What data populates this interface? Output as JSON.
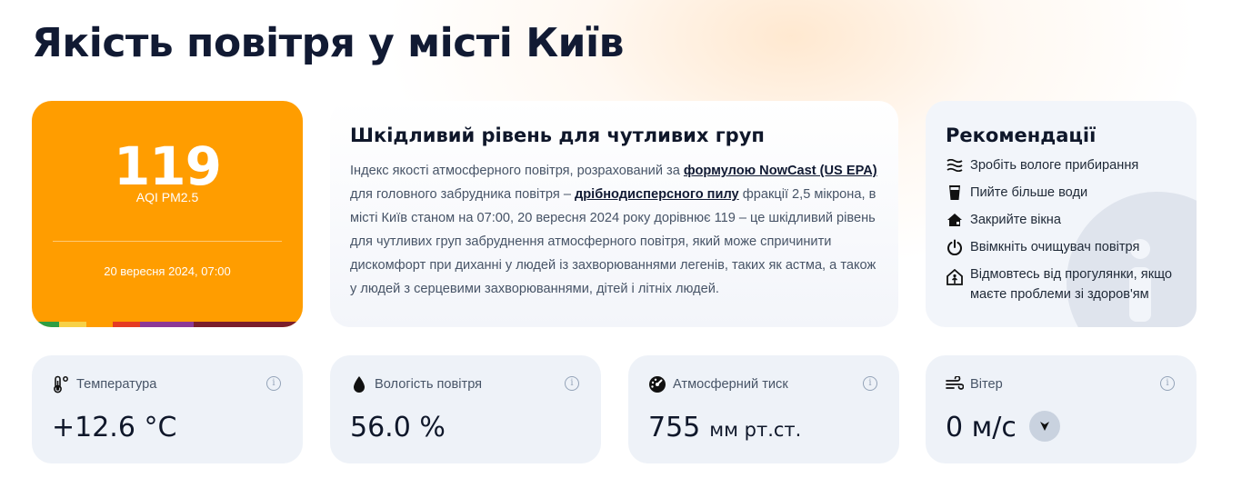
{
  "page": {
    "title": "Якість повітря у місті Київ"
  },
  "aqi": {
    "value": "119",
    "label": "AQI PM2.5",
    "date": "20 вересня 2024, 07:00",
    "color": "#ff9d00",
    "scale_colors": [
      "#2e9e44",
      "#f7d147",
      "#ff9d00",
      "#e53b23",
      "#8b3a96",
      "#7a1f2b"
    ]
  },
  "description": {
    "heading": "Шкідливий рівень для чутливих груп",
    "text_1": "Індекс якості атмосферного повітря, розрахований за ",
    "link_1": "формулою NowCast (US EPA)",
    "text_2": " для головного забрудника повітря – ",
    "link_2": "дрібнодисперсного пилу",
    "text_3": " фракції 2,5 мікрона, в місті Київ станом на 07:00, 20 вересня 2024 року дорівнює 119 – це шкідливий рівень для чутливих груп забруднення атмосферного повітря, який може спричинити дискомфорт при диханні у людей із захворюваннями легенів, таких як астма, а також у людей з серцевими захворюваннями, дітей і літніх людей."
  },
  "recommendations": {
    "heading": "Рекомендації",
    "items": [
      {
        "icon": "wet-cleaning-icon",
        "label": "Зробіть вологе прибирання"
      },
      {
        "icon": "water-glass-icon",
        "label": "Пийте більше води"
      },
      {
        "icon": "house-icon",
        "label": "Закрийте вікна"
      },
      {
        "icon": "power-icon",
        "label": "Ввімкніть очищувач повітря"
      },
      {
        "icon": "stay-home-icon",
        "label": "Відмовтесь від прогулянки, якщо маєте проблеми зі здоров'ям"
      }
    ]
  },
  "weather": {
    "temperature": {
      "label": "Температура",
      "value": "+12.6 °C"
    },
    "humidity": {
      "label": "Вологість повітря",
      "value": "56.0 %"
    },
    "pressure": {
      "label": "Атмосферний тиск",
      "value": "755",
      "unit": "мм рт.ст."
    },
    "wind": {
      "label": "Вітер",
      "value": "0 м/с"
    },
    "info_glyph": "i"
  }
}
